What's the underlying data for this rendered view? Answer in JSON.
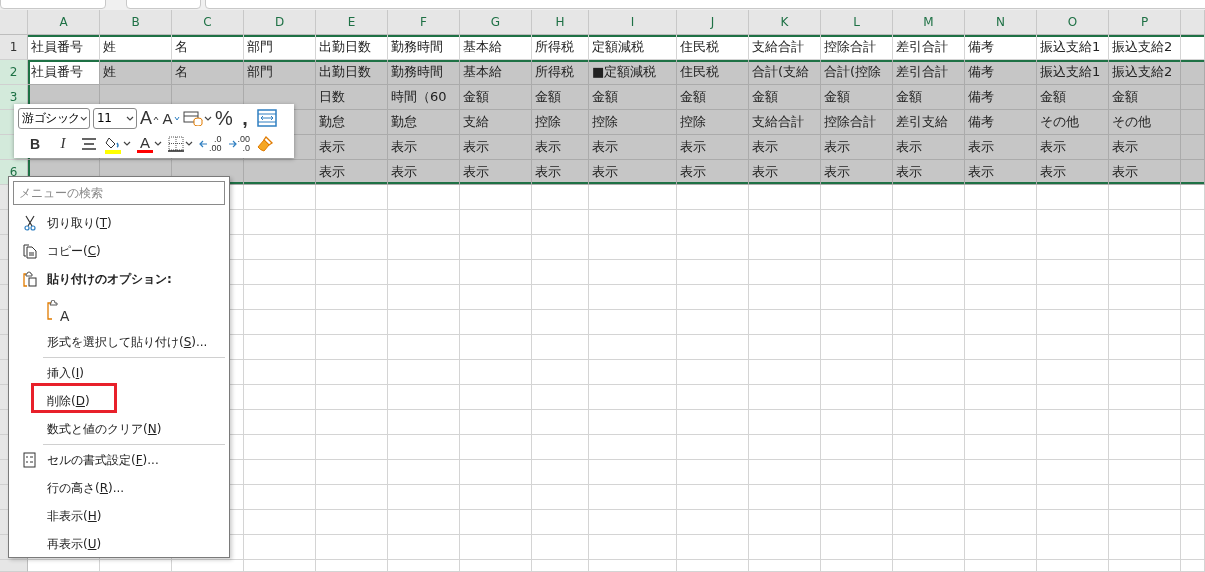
{
  "columns": [
    "A",
    "B",
    "C",
    "D",
    "E",
    "F",
    "G",
    "H",
    "I",
    "J",
    "K",
    "L",
    "M",
    "N",
    "O",
    "P"
  ],
  "rows": [
    {
      "number": "1",
      "selected": false,
      "cells": [
        "社員番号",
        "姓",
        "名",
        "部門",
        "出勤日数",
        "勤務時間",
        "基本給",
        "所得税",
        "定額減税",
        "住民税",
        "支給合計",
        "控除合計",
        "差引合計",
        "備考",
        "振込支給1",
        "振込支給2"
      ]
    },
    {
      "number": "2",
      "selected": true,
      "cells": [
        {
          "text": "社員番号",
          "active": true
        },
        "姓",
        "名",
        "部門",
        "出勤日数",
        "勤務時間",
        "基本給",
        "所得税",
        "■定額減税",
        "住民税",
        "合計(支給",
        "合計(控除",
        "差引合計",
        "備考",
        "振込支給1",
        "振込支給2"
      ]
    },
    {
      "number": "3",
      "selected": true,
      "cells": [
        null,
        null,
        null,
        null,
        "日数",
        "時間（60",
        "金額",
        "金額",
        "金額",
        "金額",
        "金額",
        "金額",
        "金額",
        "備考",
        "金額",
        "金額"
      ]
    },
    {
      "selected": true,
      "cells": [
        null,
        null,
        null,
        null,
        "勤怠",
        "勤怠",
        "支給",
        "控除",
        "控除",
        "控除",
        "支給合計",
        "控除合計",
        "差引支給",
        "備考",
        "その他",
        "その他"
      ]
    },
    {
      "selected": true,
      "cells": [
        null,
        null,
        null,
        null,
        "表示",
        "表示",
        "表示",
        "表示",
        "表示",
        "表示",
        "表示",
        "表示",
        "表示",
        "表示",
        "表示",
        "表示"
      ]
    },
    {
      "number": "6",
      "selected": true,
      "cells": [
        null,
        null,
        null,
        null,
        "表示",
        "表示",
        "表示",
        "表示",
        "表示",
        "表示",
        "表示",
        "表示",
        "表示",
        "表示",
        "表示",
        "表示"
      ]
    }
  ],
  "mini_toolbar": {
    "font": "游ゴシック",
    "size": "11",
    "row_1": [
      {
        "kind": "grow",
        "label": "A"
      },
      {
        "kind": "shrink",
        "label": "A"
      },
      {
        "kind": "styles"
      },
      {
        "kind": "percent",
        "label": "%"
      },
      {
        "kind": "comma",
        "label": ","
      },
      {
        "kind": "wrap"
      }
    ],
    "row_2": [
      {
        "kind": "bold",
        "label": "B"
      },
      {
        "kind": "italic",
        "label": "I"
      },
      {
        "kind": "align"
      },
      {
        "kind": "fill",
        "color": "#ffff00"
      },
      {
        "kind": "font-color",
        "label": "A",
        "color": "#ff0000"
      },
      {
        "kind": "borders"
      },
      {
        "kind": "increase-decimal",
        "top": ".0",
        "bottom": ".00"
      },
      {
        "kind": "decrease-decimal",
        "top": ".00",
        "bottom": ".0"
      },
      {
        "kind": "painter"
      }
    ]
  },
  "context_menu": {
    "search": {
      "placeholder": "メニューの検索"
    },
    "items": [
      {
        "kind": "cut",
        "before": "切り取り(",
        "key": "T",
        "after": ")",
        "highlighted": false
      },
      {
        "kind": "copy",
        "before": "コピー(",
        "key": "C",
        "after": ")",
        "highlighted": false
      },
      {
        "kind": "heading",
        "text": "貼り付けのオプション:"
      },
      {
        "kind": "paste-option",
        "label": "A"
      },
      {
        "kind": "item",
        "before": "形式を選択して貼り付け(",
        "key": "S",
        "after": ")...",
        "highlighted": false
      },
      {
        "kind": "separator"
      },
      {
        "kind": "item",
        "before": "挿入(",
        "key": "I",
        "after": ")",
        "highlighted": false
      },
      {
        "kind": "item",
        "before": "削除(",
        "key": "D",
        "after": ")",
        "highlighted": true
      },
      {
        "kind": "item",
        "before": "数式と値のクリア(",
        "key": "N",
        "after": ")",
        "highlighted": false
      },
      {
        "kind": "separator"
      },
      {
        "kind": "format",
        "before": "セルの書式設定(",
        "key": "F",
        "after": ")...",
        "highlighted": false
      },
      {
        "kind": "item",
        "before": "行の高さ(",
        "key": "R",
        "after": ")...",
        "highlighted": false
      },
      {
        "kind": "item",
        "before": "非表示(",
        "key": "H",
        "after": ")",
        "highlighted": false
      },
      {
        "kind": "item",
        "before": "再表示(",
        "key": "U",
        "after": ")",
        "highlighted": false
      }
    ]
  }
}
